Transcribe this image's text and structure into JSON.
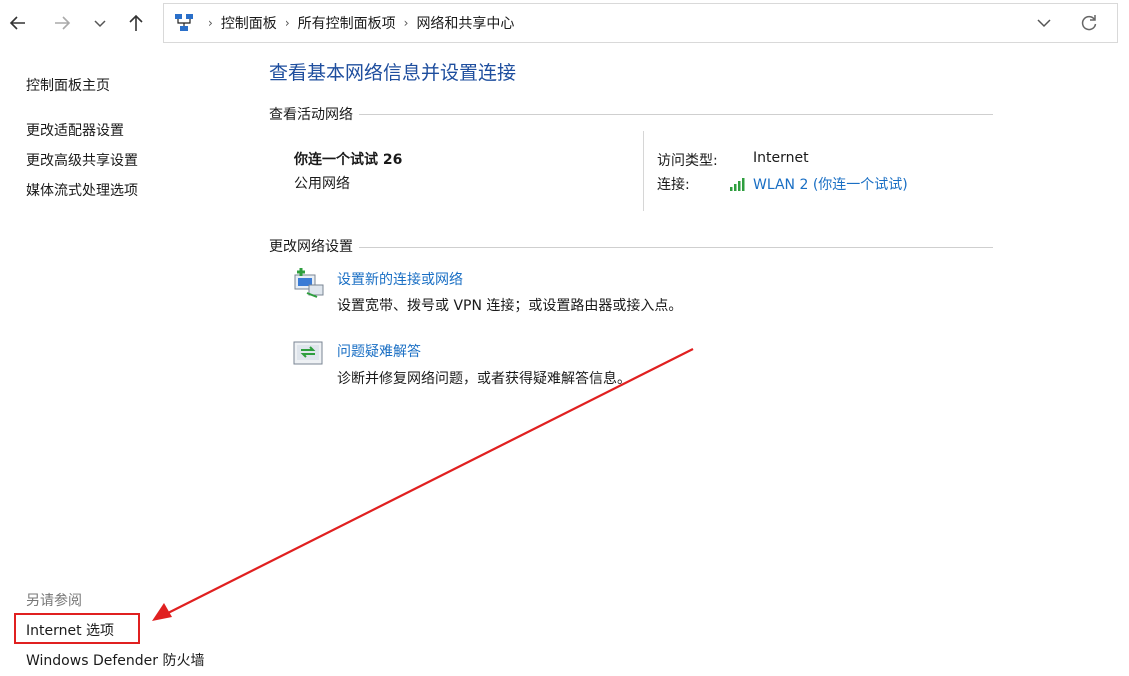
{
  "address_bar": {
    "breadcrumbs": [
      "控制面板",
      "所有控制面板项",
      "网络和共享中心"
    ]
  },
  "sidebar": {
    "links": [
      "控制面板主页",
      "更改适配器设置",
      "更改高级共享设置",
      "媒体流式处理选项"
    ],
    "see_also_heading": "另请参阅",
    "see_also_links": [
      "Internet 选项",
      "Windows Defender 防火墙"
    ]
  },
  "main": {
    "title": "查看基本网络信息并设置连接",
    "active_networks_label": "查看活动网络",
    "network": {
      "name": "你连一个试试 26",
      "category": "公用网络",
      "access_type_label": "访问类型:",
      "access_type_value": "Internet",
      "connection_label": "连接:",
      "connection_value": "WLAN 2 (你连一个试试)"
    },
    "change_settings_label": "更改网络设置",
    "tasks": [
      {
        "link": "设置新的连接或网络",
        "description": "设置宽带、拨号或 VPN 连接；或设置路由器或接入点。",
        "icon": "new-connection-icon"
      },
      {
        "link": "问题疑难解答",
        "description": "诊断并修复网络问题，或者获得疑难解答信息。",
        "icon": "troubleshoot-icon"
      }
    ]
  },
  "annotation": {
    "highlight_color": "#e02020"
  },
  "colors": {
    "title_blue": "#1e4e9e",
    "link_blue": "#1a6fc4"
  }
}
